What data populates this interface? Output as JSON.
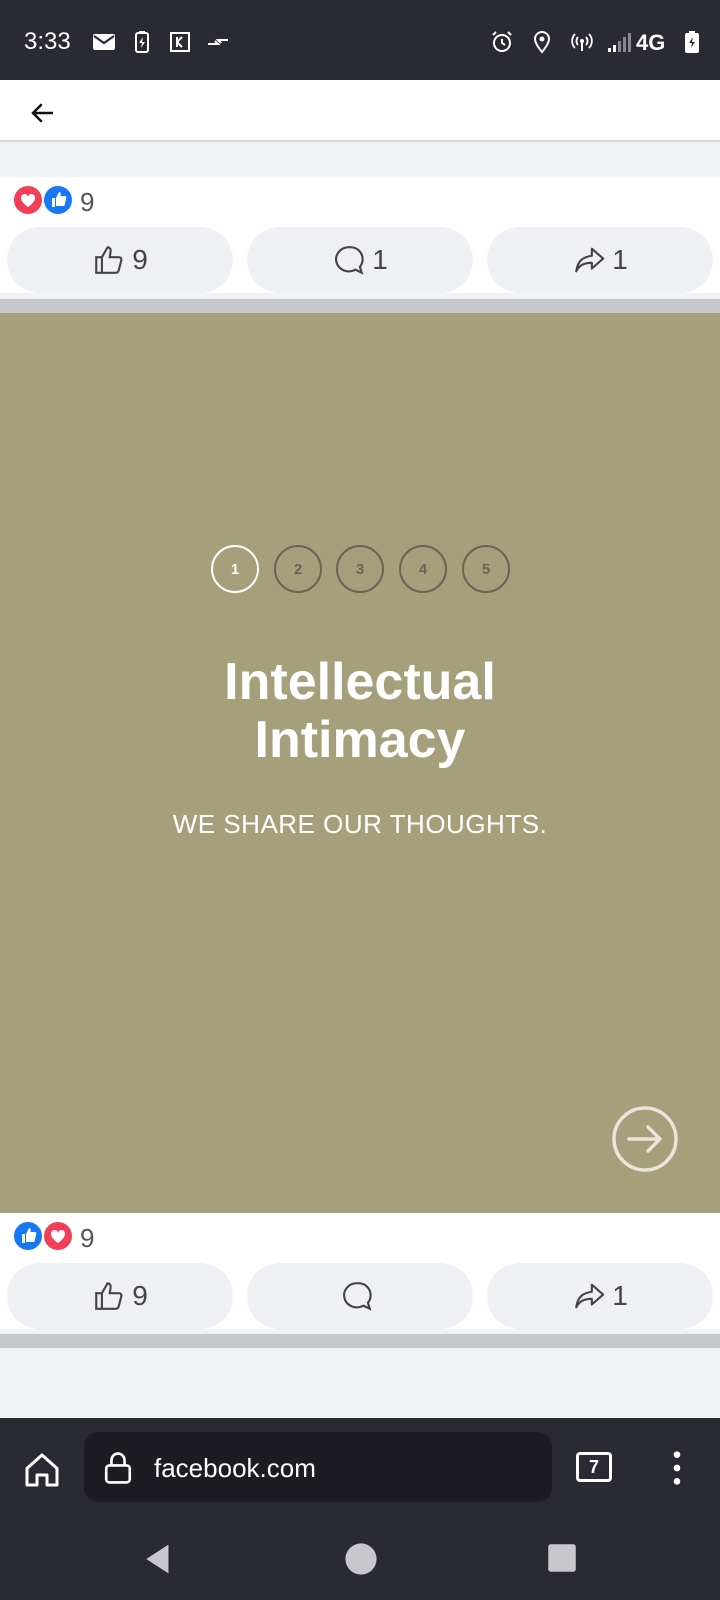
{
  "status_bar": {
    "time": "3:33",
    "left_icons": [
      "mail-icon",
      "battery-saver-icon",
      "k-app-icon",
      "data-transfer-icon"
    ],
    "right_icons": [
      "alarm-icon",
      "location-icon",
      "hotspot-icon",
      "signal-icon",
      "battery-icon"
    ],
    "network": "4G"
  },
  "top_bar": {
    "back_icon": "arrow-left-icon"
  },
  "post1": {
    "reaction_count": "9",
    "reactions": [
      "love",
      "like"
    ],
    "like_count": "9",
    "comment_count": "1",
    "share_count": "1"
  },
  "post2": {
    "carousel": {
      "steps": [
        "1",
        "2",
        "3",
        "4",
        "5"
      ],
      "active_step": 1,
      "headline_line1": "Intellectual",
      "headline_line2": "Intimacy",
      "subtitle": "WE SHARE OUR THOUGHTS.",
      "background_color": "#a69f7c"
    },
    "reaction_count": "9",
    "reactions": [
      "like",
      "love"
    ],
    "like_count": "9",
    "comment_count": "",
    "share_count": "1"
  },
  "browser": {
    "url": "facebook.com",
    "tab_count": "7"
  },
  "colors": {
    "like_blue": "#1877f2",
    "love_red": "#f33e58",
    "bar_dark": "#2a2a33"
  }
}
